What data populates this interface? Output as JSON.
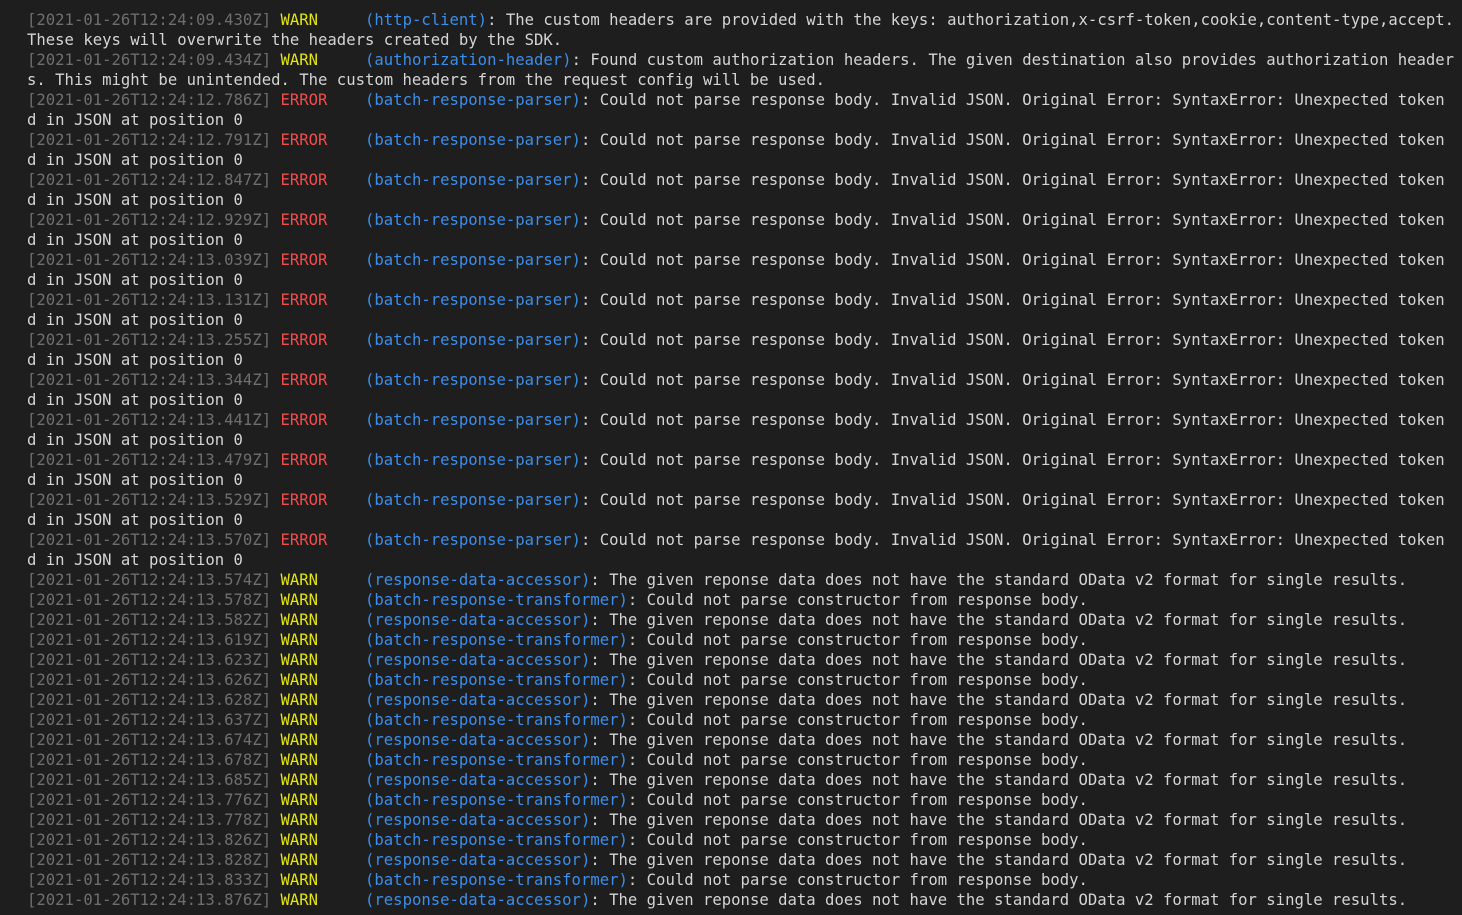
{
  "terminal": {
    "colors": {
      "background": "#1e1e1e",
      "timestamp": "#6e6e6e",
      "warn": "#e5e510",
      "error": "#f14c4c",
      "module": "#3b8eea",
      "text": "#d4d4d4"
    },
    "entries": [
      {
        "ts": "[2021-01-26T12:24:09.430Z]",
        "level": "WARN",
        "module": "(http-client)",
        "message": ": The custom headers are provided with the keys: authorization,x-csrf-token,cookie,content-type,accept. These keys will overwrite the headers created by the SDK."
      },
      {
        "ts": "[2021-01-26T12:24:09.434Z]",
        "level": "WARN",
        "module": "(authorization-header)",
        "message": ": Found custom authorization headers. The given destination also provides authorization headers. This might be unintended. The custom headers from the request config will be used."
      },
      {
        "ts": "[2021-01-26T12:24:12.786Z]",
        "level": "ERROR",
        "module": "(batch-response-parser)",
        "message": ": Could not parse response body. Invalid JSON. Original Error: SyntaxError: Unexpected token d in JSON at position 0"
      },
      {
        "ts": "[2021-01-26T12:24:12.791Z]",
        "level": "ERROR",
        "module": "(batch-response-parser)",
        "message": ": Could not parse response body. Invalid JSON. Original Error: SyntaxError: Unexpected token d in JSON at position 0"
      },
      {
        "ts": "[2021-01-26T12:24:12.847Z]",
        "level": "ERROR",
        "module": "(batch-response-parser)",
        "message": ": Could not parse response body. Invalid JSON. Original Error: SyntaxError: Unexpected token d in JSON at position 0"
      },
      {
        "ts": "[2021-01-26T12:24:12.929Z]",
        "level": "ERROR",
        "module": "(batch-response-parser)",
        "message": ": Could not parse response body. Invalid JSON. Original Error: SyntaxError: Unexpected token d in JSON at position 0"
      },
      {
        "ts": "[2021-01-26T12:24:13.039Z]",
        "level": "ERROR",
        "module": "(batch-response-parser)",
        "message": ": Could not parse response body. Invalid JSON. Original Error: SyntaxError: Unexpected token d in JSON at position 0"
      },
      {
        "ts": "[2021-01-26T12:24:13.131Z]",
        "level": "ERROR",
        "module": "(batch-response-parser)",
        "message": ": Could not parse response body. Invalid JSON. Original Error: SyntaxError: Unexpected token d in JSON at position 0"
      },
      {
        "ts": "[2021-01-26T12:24:13.255Z]",
        "level": "ERROR",
        "module": "(batch-response-parser)",
        "message": ": Could not parse response body. Invalid JSON. Original Error: SyntaxError: Unexpected token d in JSON at position 0"
      },
      {
        "ts": "[2021-01-26T12:24:13.344Z]",
        "level": "ERROR",
        "module": "(batch-response-parser)",
        "message": ": Could not parse response body. Invalid JSON. Original Error: SyntaxError: Unexpected token d in JSON at position 0"
      },
      {
        "ts": "[2021-01-26T12:24:13.441Z]",
        "level": "ERROR",
        "module": "(batch-response-parser)",
        "message": ": Could not parse response body. Invalid JSON. Original Error: SyntaxError: Unexpected token d in JSON at position 0"
      },
      {
        "ts": "[2021-01-26T12:24:13.479Z]",
        "level": "ERROR",
        "module": "(batch-response-parser)",
        "message": ": Could not parse response body. Invalid JSON. Original Error: SyntaxError: Unexpected token d in JSON at position 0"
      },
      {
        "ts": "[2021-01-26T12:24:13.529Z]",
        "level": "ERROR",
        "module": "(batch-response-parser)",
        "message": ": Could not parse response body. Invalid JSON. Original Error: SyntaxError: Unexpected token d in JSON at position 0"
      },
      {
        "ts": "[2021-01-26T12:24:13.570Z]",
        "level": "ERROR",
        "module": "(batch-response-parser)",
        "message": ": Could not parse response body. Invalid JSON. Original Error: SyntaxError: Unexpected token d in JSON at position 0"
      },
      {
        "ts": "[2021-01-26T12:24:13.574Z]",
        "level": "WARN",
        "module": "(response-data-accessor)",
        "message": ": The given reponse data does not have the standard OData v2 format for single results."
      },
      {
        "ts": "[2021-01-26T12:24:13.578Z]",
        "level": "WARN",
        "module": "(batch-response-transformer)",
        "message": ": Could not parse constructor from response body."
      },
      {
        "ts": "[2021-01-26T12:24:13.582Z]",
        "level": "WARN",
        "module": "(response-data-accessor)",
        "message": ": The given reponse data does not have the standard OData v2 format for single results."
      },
      {
        "ts": "[2021-01-26T12:24:13.619Z]",
        "level": "WARN",
        "module": "(batch-response-transformer)",
        "message": ": Could not parse constructor from response body."
      },
      {
        "ts": "[2021-01-26T12:24:13.623Z]",
        "level": "WARN",
        "module": "(response-data-accessor)",
        "message": ": The given reponse data does not have the standard OData v2 format for single results."
      },
      {
        "ts": "[2021-01-26T12:24:13.626Z]",
        "level": "WARN",
        "module": "(batch-response-transformer)",
        "message": ": Could not parse constructor from response body."
      },
      {
        "ts": "[2021-01-26T12:24:13.628Z]",
        "level": "WARN",
        "module": "(response-data-accessor)",
        "message": ": The given reponse data does not have the standard OData v2 format for single results."
      },
      {
        "ts": "[2021-01-26T12:24:13.637Z]",
        "level": "WARN",
        "module": "(batch-response-transformer)",
        "message": ": Could not parse constructor from response body."
      },
      {
        "ts": "[2021-01-26T12:24:13.674Z]",
        "level": "WARN",
        "module": "(response-data-accessor)",
        "message": ": The given reponse data does not have the standard OData v2 format for single results."
      },
      {
        "ts": "[2021-01-26T12:24:13.678Z]",
        "level": "WARN",
        "module": "(batch-response-transformer)",
        "message": ": Could not parse constructor from response body."
      },
      {
        "ts": "[2021-01-26T12:24:13.685Z]",
        "level": "WARN",
        "module": "(response-data-accessor)",
        "message": ": The given reponse data does not have the standard OData v2 format for single results."
      },
      {
        "ts": "[2021-01-26T12:24:13.776Z]",
        "level": "WARN",
        "module": "(batch-response-transformer)",
        "message": ": Could not parse constructor from response body."
      },
      {
        "ts": "[2021-01-26T12:24:13.778Z]",
        "level": "WARN",
        "module": "(response-data-accessor)",
        "message": ": The given reponse data does not have the standard OData v2 format for single results."
      },
      {
        "ts": "[2021-01-26T12:24:13.826Z]",
        "level": "WARN",
        "module": "(batch-response-transformer)",
        "message": ": Could not parse constructor from response body."
      },
      {
        "ts": "[2021-01-26T12:24:13.828Z]",
        "level": "WARN",
        "module": "(response-data-accessor)",
        "message": ": The given reponse data does not have the standard OData v2 format for single results."
      },
      {
        "ts": "[2021-01-26T12:24:13.833Z]",
        "level": "WARN",
        "module": "(batch-response-transformer)",
        "message": ": Could not parse constructor from response body."
      },
      {
        "ts": "[2021-01-26T12:24:13.876Z]",
        "level": "WARN",
        "module": "(response-data-accessor)",
        "message": ": The given reponse data does not have the standard OData v2 format for single results."
      }
    ]
  }
}
